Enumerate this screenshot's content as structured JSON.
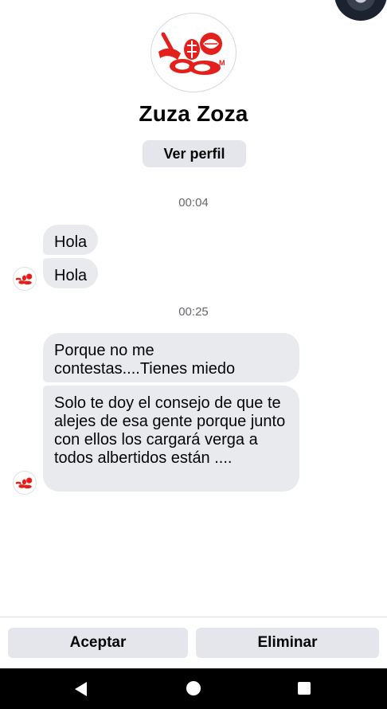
{
  "profile": {
    "name": "Zuza Zoza",
    "view_profile_label": "Ver perfil",
    "avatar_icon": "restaurant-logo-icon"
  },
  "conversation": {
    "groups": [
      {
        "time": "00:04",
        "messages": [
          "Hola",
          "Hola"
        ]
      },
      {
        "time": "00:25",
        "messages": [
          "Porque no me contestas....Tienes miedo",
          "Solo te doy el consejo de que te alejes de esa gente porque junto con ellos los cargará verga a todos albertidos están ...."
        ]
      }
    ]
  },
  "actions": {
    "accept_label": "Aceptar",
    "delete_label": "Eliminar"
  },
  "nav_bar": {
    "back_icon": "back-triangle-icon",
    "home_icon": "home-circle-icon",
    "recents_icon": "recents-square-icon"
  },
  "colors": {
    "logo_red": "#e3201b",
    "bubble_bg": "#e9eaee",
    "button_bg": "#e4e6eb",
    "timestamp": "#65676b",
    "nav_bg": "#000000"
  }
}
